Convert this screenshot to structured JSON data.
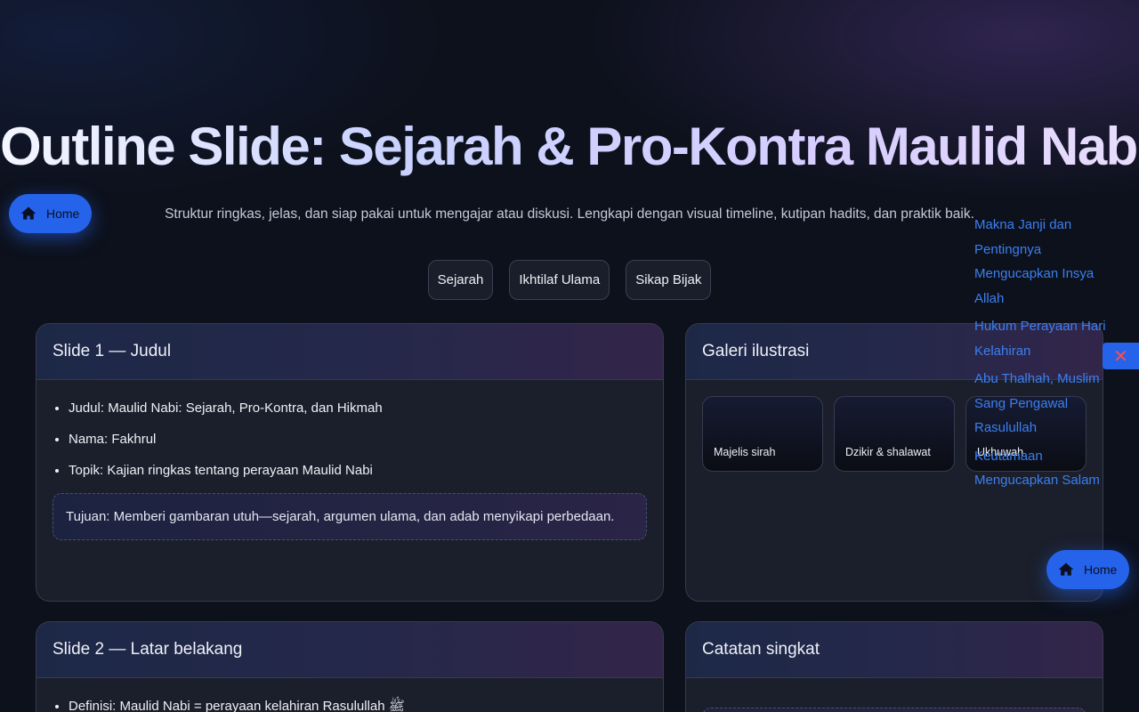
{
  "hero": {
    "title": "Outline Slide: Sejarah & Pro-Kontra Maulid Nabi",
    "subtitle": "Struktur ringkas, jelas, dan siap pakai untuk mengajar atau diskusi. Lengkapi dengan visual timeline, kutipan hadits, dan praktik baik."
  },
  "pills": [
    "Sejarah",
    "Ikhtilaf Ulama",
    "Sikap Bijak"
  ],
  "home_button": {
    "label": "Home",
    "icon": "home-icon"
  },
  "slide1": {
    "title": "Slide 1 — Judul",
    "items": [
      "Judul: Maulid Nabi: Sejarah, Pro-Kontra, dan Hikmah",
      "Nama: Fakhrul",
      "Topik: Kajian ringkas tentang perayaan Maulid Nabi"
    ],
    "note": "Tujuan: Memberi gambaran utuh—sejarah, argumen ulama, dan adab menyikapi perbedaan."
  },
  "gallery": {
    "title": "Galeri ilustrasi",
    "thumbs": [
      "Majelis sirah",
      "Dzikir & shalawat",
      "Ukhuwah"
    ]
  },
  "side_links": [
    "Makna Janji dan Pentingnya Mengucapkan Insya Allah",
    "Hukum Perayaan Hari Kelahiran",
    "Abu Thalhah, Muslim Sang Pengawal Rasulullah",
    "Keutamaan Mengucapkan Salam"
  ],
  "close_button": {
    "icon": "close-icon",
    "glyph": "✕"
  },
  "slide2": {
    "title": "Slide 2 — Latar belakang",
    "first_item": "Definisi: Maulid Nabi = perayaan kelahiran Rasulullah ﷺ"
  },
  "notes_card": {
    "title": "Catatan singkat"
  },
  "colors": {
    "accent": "#2563eb",
    "link": "#3b7ff0",
    "background": "#0d111c",
    "close": "#ff4d4d"
  }
}
